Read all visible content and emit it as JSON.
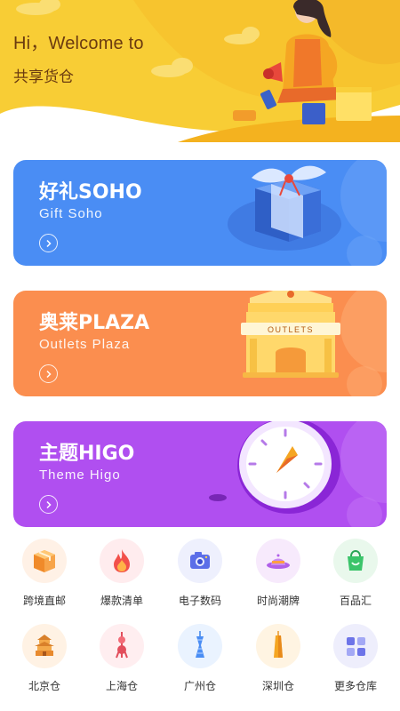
{
  "header": {
    "greeting": "Hi，Welcome to",
    "app_name": "共享货仓"
  },
  "cards": [
    {
      "title": "好礼SOHO",
      "subtitle": "Gift Soho",
      "color": "#4a8df4"
    },
    {
      "title": "奥莱PLAZA",
      "subtitle": "Outlets Plaza",
      "color": "#fb8e4f",
      "sign_text": "OUTLETS"
    },
    {
      "title": "主题HIGO",
      "subtitle": "Theme Higo",
      "color": "#b04ff0"
    }
  ],
  "categories_row1": [
    {
      "label": "跨境直邮",
      "icon": "parcel-icon",
      "bg": "#fff1e6"
    },
    {
      "label": "爆款清单",
      "icon": "fire-icon",
      "bg": "#ffecee"
    },
    {
      "label": "电子数码",
      "icon": "camera-icon",
      "bg": "#eef0fd"
    },
    {
      "label": "时尚潮牌",
      "icon": "hat-icon",
      "bg": "#f7eafc"
    },
    {
      "label": "百品汇",
      "icon": "shopping-bag-icon",
      "bg": "#e9f8ec"
    }
  ],
  "categories_row2": [
    {
      "label": "北京仓",
      "icon": "temple-icon",
      "bg": "#fff2e4"
    },
    {
      "label": "上海仓",
      "icon": "tv-tower-icon",
      "bg": "#ffeef0"
    },
    {
      "label": "广州仓",
      "icon": "canton-tower-icon",
      "bg": "#eaf3ff"
    },
    {
      "label": "深圳仓",
      "icon": "skyscraper-icon",
      "bg": "#fff4e2"
    },
    {
      "label": "更多仓库",
      "icon": "grid-more-icon",
      "bg": "#eeeefc"
    }
  ]
}
